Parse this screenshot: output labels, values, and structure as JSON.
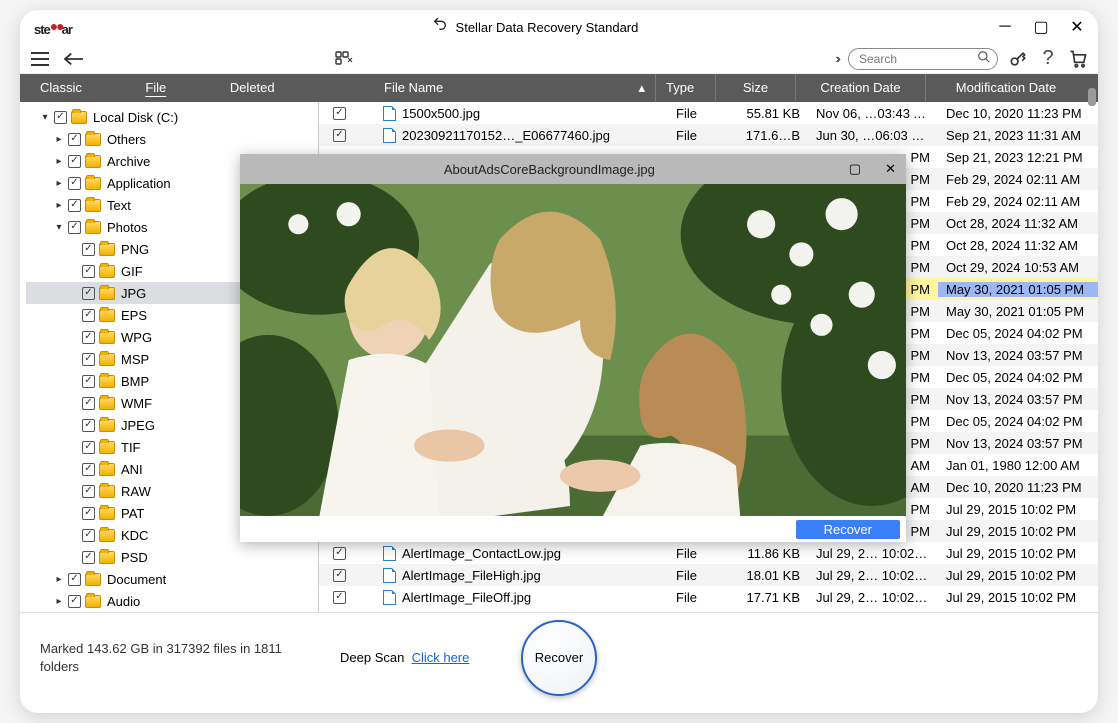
{
  "app": {
    "logo_pre": "ste",
    "logo_post": "ar",
    "title": "Stellar Data Recovery Standard"
  },
  "search": {
    "placeholder": "Search"
  },
  "tabs": {
    "classic": "Classic List",
    "file": "File List",
    "deleted": "Deleted List"
  },
  "cols": {
    "name": "File Name",
    "type": "Type",
    "size": "Size",
    "cdate": "Creation Date",
    "mdate": "Modification Date"
  },
  "tree": {
    "root": "Local Disk (C:)",
    "items": [
      "Others",
      "Archive",
      "Application",
      "Text",
      "Photos",
      "Document",
      "Audio"
    ],
    "photos_children": [
      "PNG",
      "GIF",
      "JPG",
      "EPS",
      "WPG",
      "MSP",
      "BMP",
      "WMF",
      "JPEG",
      "TIF",
      "ANI",
      "RAW",
      "PAT",
      "KDC",
      "PSD"
    ]
  },
  "rows": [
    {
      "name": "1500x500.jpg",
      "type": "File",
      "size": "55.81 KB",
      "cdate": "Nov 06, …03:43 AM",
      "mdate": "Dec 10, 2020 11:23 PM"
    },
    {
      "name": "20230921170152…_E06677460.jpg",
      "type": "File",
      "size": "171.6…B",
      "cdate": "Jun 30, …06:03 PM",
      "mdate": "Sep 21, 2023 11:31 AM"
    },
    {
      "name": "",
      "type": "",
      "size": "",
      "cdate": "PM",
      "mdate": "Sep 21, 2023 12:21 PM"
    },
    {
      "name": "",
      "type": "",
      "size": "",
      "cdate": "PM",
      "mdate": "Feb 29, 2024 02:11 AM"
    },
    {
      "name": "",
      "type": "",
      "size": "",
      "cdate": "PM",
      "mdate": "Feb 29, 2024 02:11 AM"
    },
    {
      "name": "",
      "type": "",
      "size": "",
      "cdate": "PM",
      "mdate": "Oct 28, 2024 11:32 AM"
    },
    {
      "name": "",
      "type": "",
      "size": "",
      "cdate": "PM",
      "mdate": "Oct 28, 2024 11:32 AM"
    },
    {
      "name": "",
      "type": "",
      "size": "",
      "cdate": "PM",
      "mdate": "Oct 29, 2024 10:53 AM"
    },
    {
      "name": "",
      "type": "",
      "size": "",
      "cdate": "PM",
      "mdate": "May 30, 2021 01:05 PM",
      "sel": true
    },
    {
      "name": "",
      "type": "",
      "size": "",
      "cdate": "PM",
      "mdate": "May 30, 2021 01:05 PM"
    },
    {
      "name": "",
      "type": "",
      "size": "",
      "cdate": "PM",
      "mdate": "Dec 05, 2024 04:02 PM"
    },
    {
      "name": "",
      "type": "",
      "size": "",
      "cdate": "PM",
      "mdate": "Nov 13, 2024 03:57 PM"
    },
    {
      "name": "",
      "type": "",
      "size": "",
      "cdate": "PM",
      "mdate": "Dec 05, 2024 04:02 PM"
    },
    {
      "name": "",
      "type": "",
      "size": "",
      "cdate": "PM",
      "mdate": "Nov 13, 2024 03:57 PM"
    },
    {
      "name": "",
      "type": "",
      "size": "",
      "cdate": "PM",
      "mdate": "Dec 05, 2024 04:02 PM"
    },
    {
      "name": "",
      "type": "",
      "size": "",
      "cdate": "PM",
      "mdate": "Nov 13, 2024 03:57 PM"
    },
    {
      "name": "",
      "type": "",
      "size": "",
      "cdate": "AM",
      "mdate": "Jan 01, 1980 12:00 AM"
    },
    {
      "name": "",
      "type": "",
      "size": "",
      "cdate": "AM",
      "mdate": "Dec 10, 2020 11:23 PM"
    },
    {
      "name": "",
      "type": "",
      "size": "",
      "cdate": "PM",
      "mdate": "Jul 29, 2015 10:02 PM"
    },
    {
      "name": "",
      "type": "",
      "size": "",
      "cdate": "PM",
      "mdate": "Jul 29, 2015 10:02 PM"
    },
    {
      "name": "AlertImage_ContactLow.jpg",
      "type": "File",
      "size": "11.86 KB",
      "cdate": "Jul 29, 2… 10:02 PM",
      "mdate": "Jul 29, 2015 10:02 PM"
    },
    {
      "name": "AlertImage_FileHigh.jpg",
      "type": "File",
      "size": "18.01 KB",
      "cdate": "Jul 29, 2… 10:02 PM",
      "mdate": "Jul 29, 2015 10:02 PM"
    },
    {
      "name": "AlertImage_FileOff.jpg",
      "type": "File",
      "size": "17.71 KB",
      "cdate": "Jul 29, 2… 10:02 PM",
      "mdate": "Jul 29, 2015 10:02 PM"
    }
  ],
  "preview": {
    "filename": "AboutAdsCoreBackgroundImage.jpg",
    "recover": "Recover"
  },
  "footer": {
    "status": "Marked 143.62 GB in 317392 files in 1811 folders",
    "deepscan_label": "Deep Scan",
    "deepscan_link": "Click here",
    "recover": "Recover"
  }
}
